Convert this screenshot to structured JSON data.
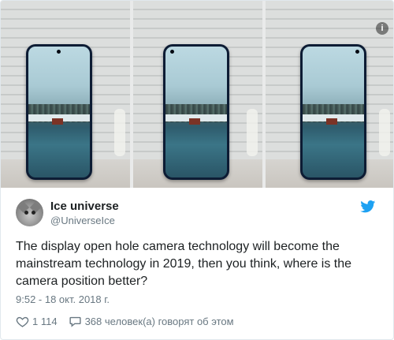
{
  "tweet": {
    "display_name": "Ice universe",
    "screen_name": "@UniverseIce",
    "text": "The display open hole camera technology will become the mainstream technology in 2019, then you think, where is the camera position better?",
    "timestamp": "9:52 - 18 окт. 2018 г.",
    "likes": "1 114",
    "replies_text": "368 человек(а) говорят об этом"
  },
  "media": {
    "info_label": "i",
    "phones": [
      {
        "camera_position": "top-center"
      },
      {
        "camera_position": "top-left"
      },
      {
        "camera_position": "top-right"
      }
    ]
  },
  "icons": {
    "twitter": "twitter-bird-icon",
    "like": "heart-icon",
    "reply": "speech-bubble-icon",
    "info": "info-icon"
  },
  "colors": {
    "twitter_blue": "#1da1f2",
    "secondary_text": "#697882",
    "primary_text": "#1c2022"
  }
}
